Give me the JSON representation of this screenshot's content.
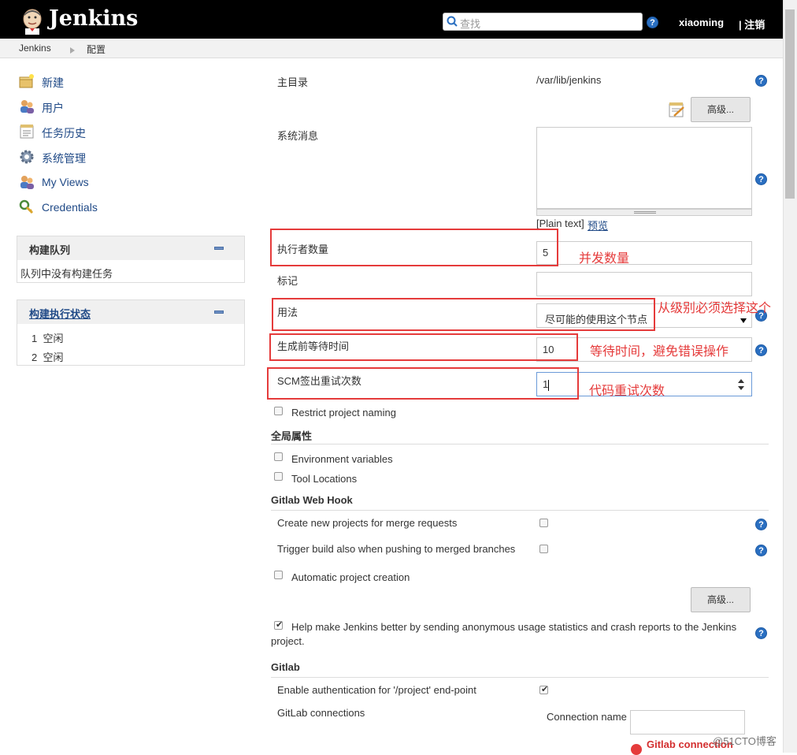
{
  "header": {
    "app_name": "Jenkins",
    "search_placeholder": "查找",
    "user": "xiaoming",
    "logout": "| 注销"
  },
  "breadcrumb": [
    "Jenkins",
    "配置"
  ],
  "sidebar": {
    "items": [
      {
        "label": "新建",
        "icon": "new-item-icon"
      },
      {
        "label": "用户",
        "icon": "users-icon"
      },
      {
        "label": "任务历史",
        "icon": "history-icon"
      },
      {
        "label": "系统管理",
        "icon": "gear-icon"
      },
      {
        "label": "My Views",
        "icon": "users-icon"
      },
      {
        "label": "Credentials",
        "icon": "key-icon"
      }
    ],
    "build_queue": {
      "title": "构建队列",
      "empty_text": "队列中没有构建任务"
    },
    "executors": {
      "title": "构建执行状态",
      "rows": [
        {
          "num": "1",
          "status": "空闲"
        },
        {
          "num": "2",
          "status": "空闲"
        }
      ]
    }
  },
  "form": {
    "home_dir_label": "主目录",
    "home_dir_value": "/var/lib/jenkins",
    "advanced_label": "高级...",
    "system_message_label": "系统消息",
    "plain_text": "[Plain text]",
    "preview": "预览",
    "executors_label": "执行者数量",
    "executors_value": "5",
    "labels_label": "标记",
    "usage_label": "用法",
    "usage_value": "尽可能的使用这个节点",
    "quiet_period_label": "生成前等待时间",
    "quiet_period_value": "10",
    "scm_retry_label": "SCM签出重试次数",
    "scm_retry_value": "1",
    "restrict_naming": "Restrict project naming",
    "global_props_title": "全局属性",
    "env_vars": "Environment variables",
    "tool_locations": "Tool Locations",
    "gitlab_hook_title": "Gitlab Web Hook",
    "create_projects_mr": "Create new projects for merge requests",
    "trigger_build_push": "Trigger build also when pushing to merged branches",
    "auto_project_creation": "Automatic project creation",
    "usage_stats_line1": "Help make Jenkins better by sending anonymous usage statistics and crash reports to the Jenkins",
    "usage_stats_line2": "project.",
    "gitlab_title": "Gitlab",
    "enable_auth": "Enable authentication for '/project' end-point",
    "gitlab_connections": "GitLab connections",
    "connection_name": "Connection name",
    "gitlab_connection_error": "Gitlab connection"
  },
  "annotations": {
    "executors": "并发数量",
    "usage": "从级别必须选择这个",
    "quiet_period": "等待时间，避免错误操作",
    "scm_retry": "代码重试次数"
  },
  "watermark": "@51CTO博客",
  "colors": {
    "header_bg": "#000000",
    "link": "#204a87",
    "annotation_red": "#e53b3b",
    "help_blue": "#2a6fc1"
  }
}
